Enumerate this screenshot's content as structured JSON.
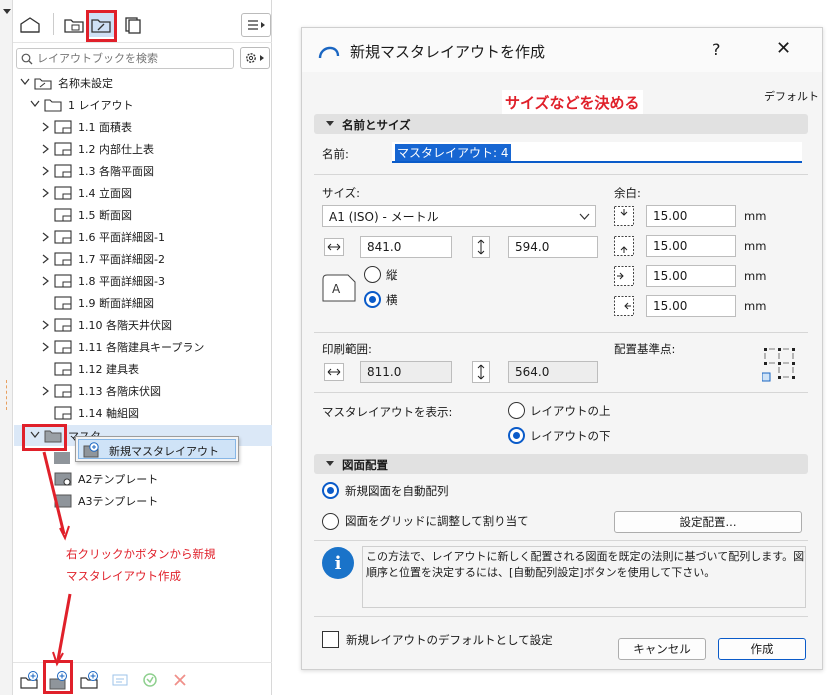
{
  "left": {
    "search_placeholder": "レイアウトブックを検索",
    "tree": {
      "root": "名称未設定",
      "folder": "1 レイアウト",
      "items": [
        "1.1 面積表",
        "1.2 内部仕上表",
        "1.3 各階平面図",
        "1.4 立面図",
        "1.5 断面図",
        "1.6 平面詳細図-1",
        "1.7 平面詳細図-2",
        "1.8 平面詳細図-3",
        "1.9 断面詳細図",
        "1.10 各階天井伏図",
        "1.11 各階建具キープラン",
        "1.12 建具表",
        "1.13 各階床伏図",
        "1.14 軸組図"
      ],
      "master_folder": "マスタ",
      "context_item": "新規マスタレイアウト",
      "masters": [
        "A2テンプレート",
        "A3テンプレート"
      ]
    },
    "annotation": [
      "右クリックかボタンから新規",
      "マスタレイアウト作成"
    ]
  },
  "dialog": {
    "title": "新規マスタレイアウトを作成",
    "help": "?",
    "close": "✕",
    "default_label": "デフォルト",
    "highlight": "サイズなどを決める",
    "section_name": "名前とサイズ",
    "name_label": "名前:",
    "name_value": "マスタレイアウト: 4",
    "size_label": "サイズ:",
    "size_value": "A1 (ISO) - メートル",
    "width": "841.0",
    "height": "594.0",
    "orient_portrait": "縦",
    "orient_landscape": "横",
    "margin_label": "余白:",
    "margins": [
      "15.00",
      "15.00",
      "15.00",
      "15.00"
    ],
    "unit": "mm",
    "print_label": "印刷範囲:",
    "print_w": "811.0",
    "print_h": "564.0",
    "anchor_label": "配置基準点:",
    "show_label": "マスタレイアウトを表示:",
    "show_above": "レイアウトの上",
    "show_below": "レイアウトの下",
    "section_drawing": "図面配置",
    "auto_place": "新規図面を自動配列",
    "grid_place": "図面をグリッドに調整して割り当て",
    "settings_button": "設定配置...",
    "info_text": [
      "この方法で、レイアウトに新しく配置される図面を既定の法則に基づいて配列します。図面の",
      "順序と位置を決定するには、[自動配列設定]ボタンを使用して下さい。"
    ],
    "default_checkbox": "新規レイアウトのデフォルトとして設定",
    "cancel": "キャンセル",
    "create": "作成"
  }
}
